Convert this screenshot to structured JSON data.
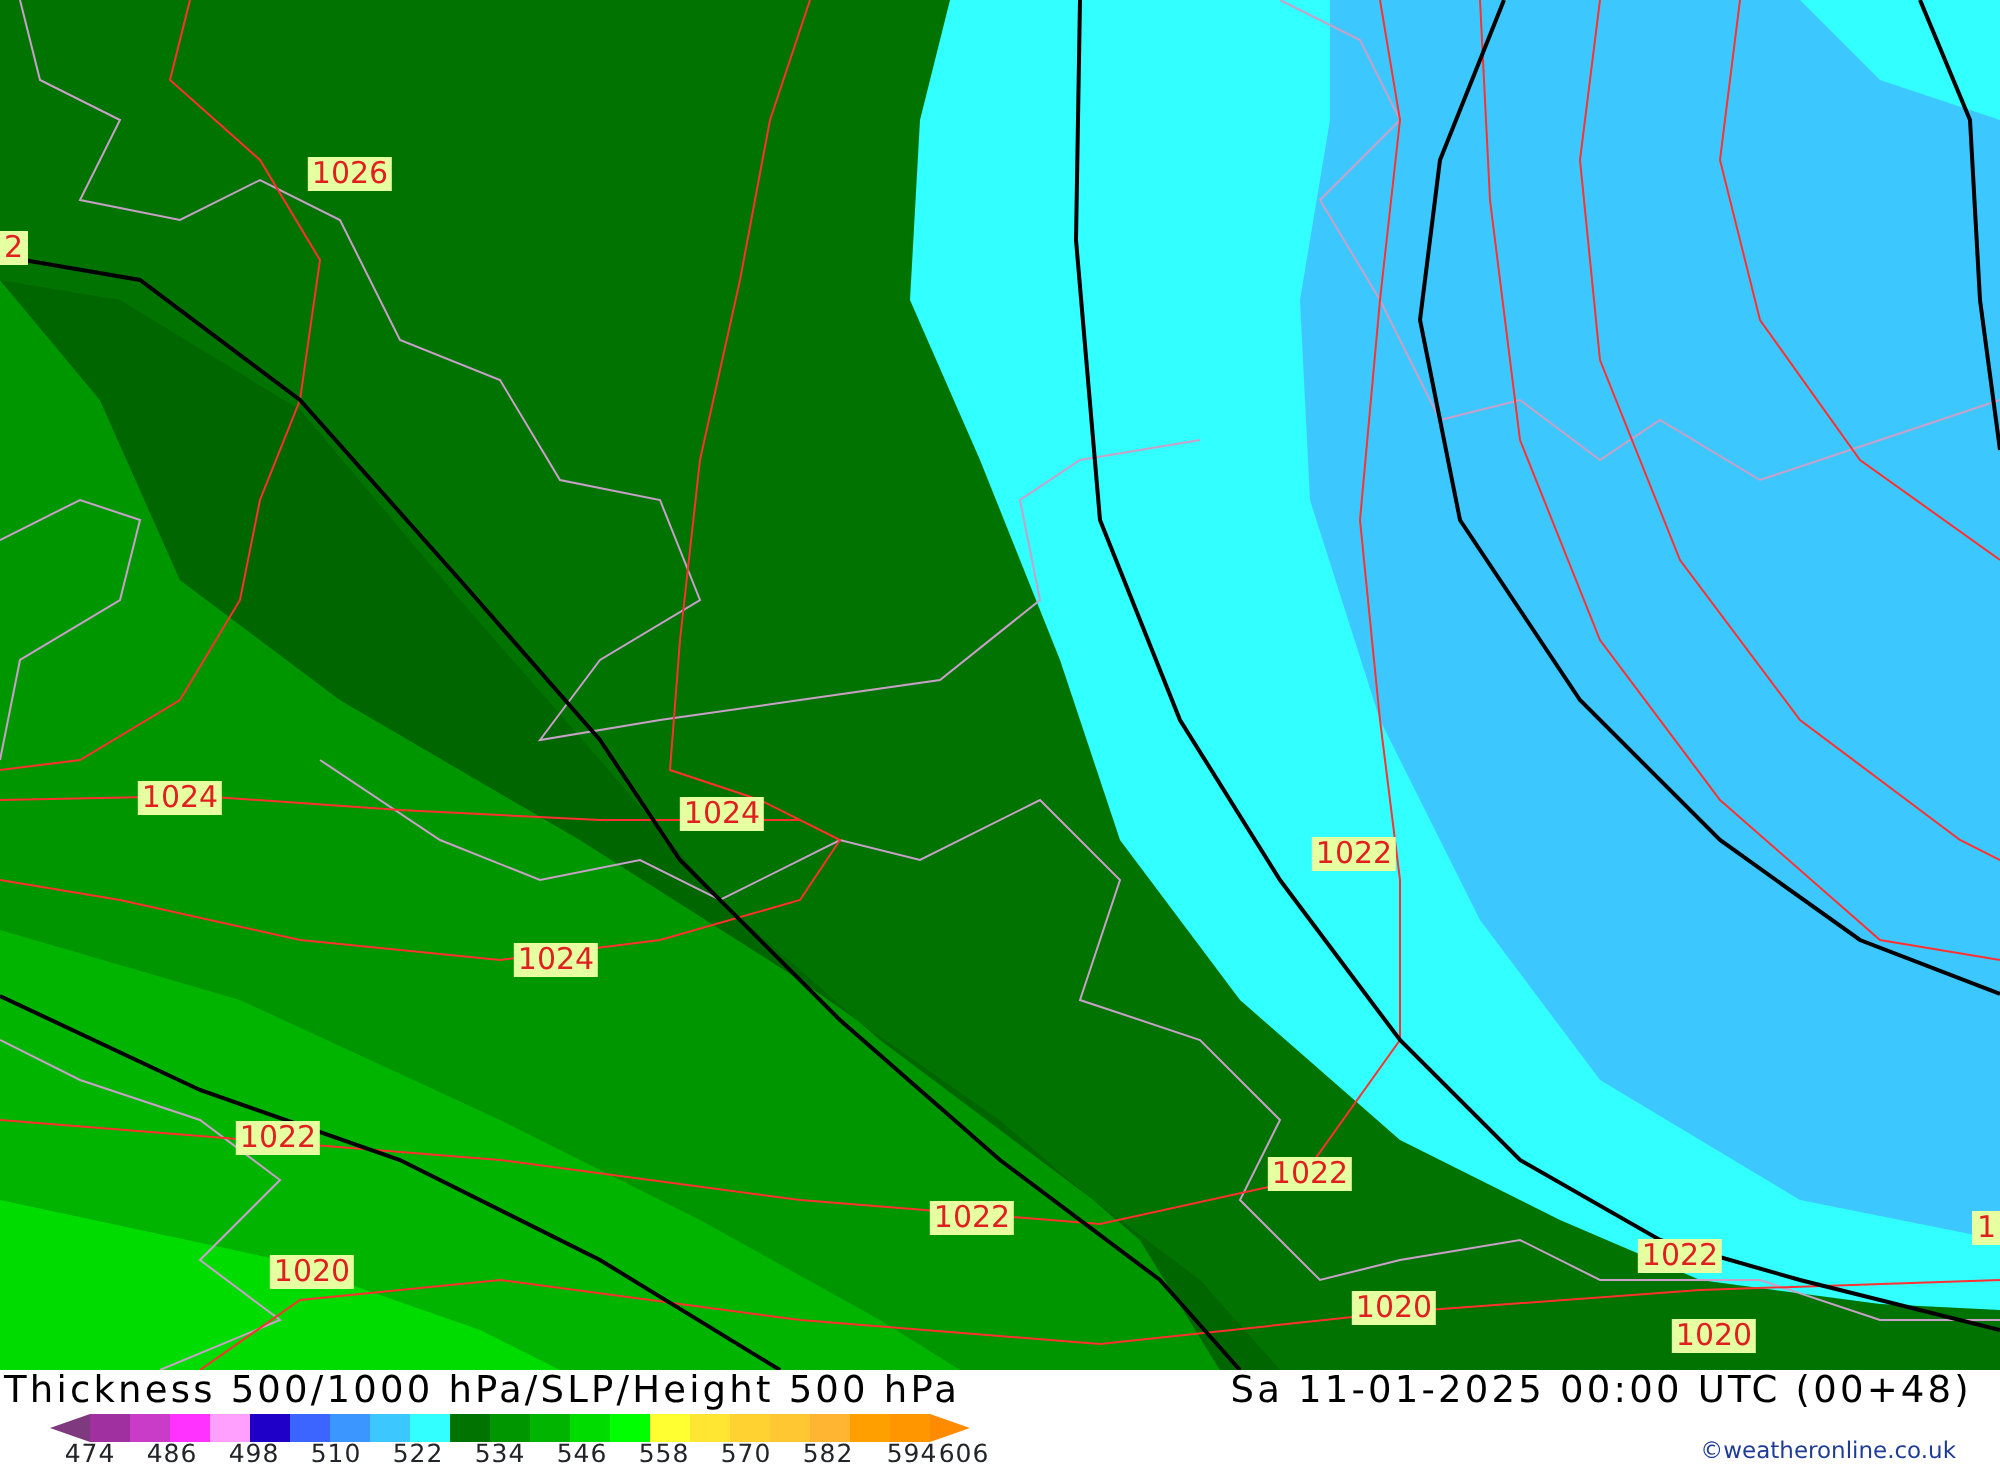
{
  "map": {
    "pressure_labels": [
      {
        "text": "1026"
      },
      {
        "text": "2"
      },
      {
        "text": "1024"
      },
      {
        "text": "1024"
      },
      {
        "text": "1024"
      },
      {
        "text": "1022"
      },
      {
        "text": "1022"
      },
      {
        "text": "1022"
      },
      {
        "text": "1022"
      },
      {
        "text": "1022"
      },
      {
        "text": "1"
      },
      {
        "text": "1020"
      },
      {
        "text": "1020"
      },
      {
        "text": "1020"
      }
    ]
  },
  "title": "Thickness 500/1000 hPa/SLP/Height 500 hPa",
  "valid_time": "Sa 11-01-2025 00:00 UTC (00+48)",
  "legend": {
    "items": [
      {
        "kind": "arrow-left",
        "color": "#7f3a7f"
      },
      {
        "kind": "cell",
        "color": "#a0309f"
      },
      {
        "kind": "cell",
        "color": "#c83cc8"
      },
      {
        "kind": "cell",
        "color": "#ff32ff"
      },
      {
        "kind": "cell",
        "color": "#ffa0ff"
      },
      {
        "kind": "cell",
        "color": "#1e00c8"
      },
      {
        "kind": "cell",
        "color": "#3c64ff"
      },
      {
        "kind": "cell",
        "color": "#3c96ff"
      },
      {
        "kind": "cell",
        "color": "#3cc8ff"
      },
      {
        "kind": "cell",
        "color": "#32ffff"
      },
      {
        "kind": "cell",
        "color": "#007300"
      },
      {
        "kind": "cell",
        "color": "#009600"
      },
      {
        "kind": "cell",
        "color": "#00b400"
      },
      {
        "kind": "cell",
        "color": "#00dc00"
      },
      {
        "kind": "cell",
        "color": "#00ff00"
      },
      {
        "kind": "cell",
        "color": "#ffff32"
      },
      {
        "kind": "cell",
        "color": "#ffe632"
      },
      {
        "kind": "cell",
        "color": "#ffd232"
      },
      {
        "kind": "cell",
        "color": "#ffc832"
      },
      {
        "kind": "cell",
        "color": "#ffb432"
      },
      {
        "kind": "cell",
        "color": "#ffa000"
      },
      {
        "kind": "cell",
        "color": "#ff9600"
      },
      {
        "kind": "arrow-right",
        "color": "#ff8c00"
      }
    ],
    "ticks": [
      "474",
      "486",
      "498",
      "510",
      "522",
      "534",
      "546",
      "558",
      "570",
      "582",
      "594",
      "606"
    ]
  },
  "credit": "©weatheronline.co.uk"
}
